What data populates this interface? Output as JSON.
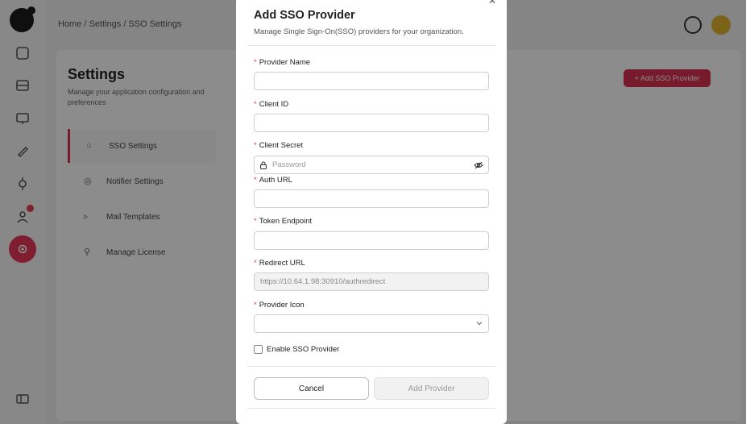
{
  "background": {
    "breadcrumb": "Home / Settings / SSO Settings",
    "settings_title": "Settings",
    "settings_subtitle": "Manage your application configuration and preferences",
    "add_sso_button": "+ Add SSO Provider",
    "nav": [
      {
        "label": "SSO Settings",
        "active": true
      },
      {
        "label": "Notifier Settings",
        "active": false
      },
      {
        "label": "Mail Templates",
        "active": false
      },
      {
        "label": "Manage License",
        "active": false
      }
    ],
    "accent_color": "#d9304f"
  },
  "modal": {
    "title": "Add SSO Provider",
    "subtitle": "Manage Single Sign-On(SSO) providers for your organization.",
    "required_marker": "*",
    "fields": {
      "provider_name": {
        "label": "Provider Name",
        "value": ""
      },
      "client_id": {
        "label": "Client ID",
        "value": ""
      },
      "client_secret": {
        "label": "Client Secret",
        "placeholder": "Password",
        "value": ""
      },
      "auth_url": {
        "label": "Auth URL",
        "value": ""
      },
      "token_endpoint": {
        "label": "Token Endpoint",
        "value": ""
      },
      "redirect_url": {
        "label": "Redirect URL",
        "value": "https://10.64.1.98:30910/authredirect"
      },
      "provider_icon": {
        "label": "Provider Icon",
        "value": ""
      }
    },
    "enable_label": "Enable SSO Provider",
    "enable_checked": false,
    "cancel_label": "Cancel",
    "add_label": "Add Provider"
  }
}
